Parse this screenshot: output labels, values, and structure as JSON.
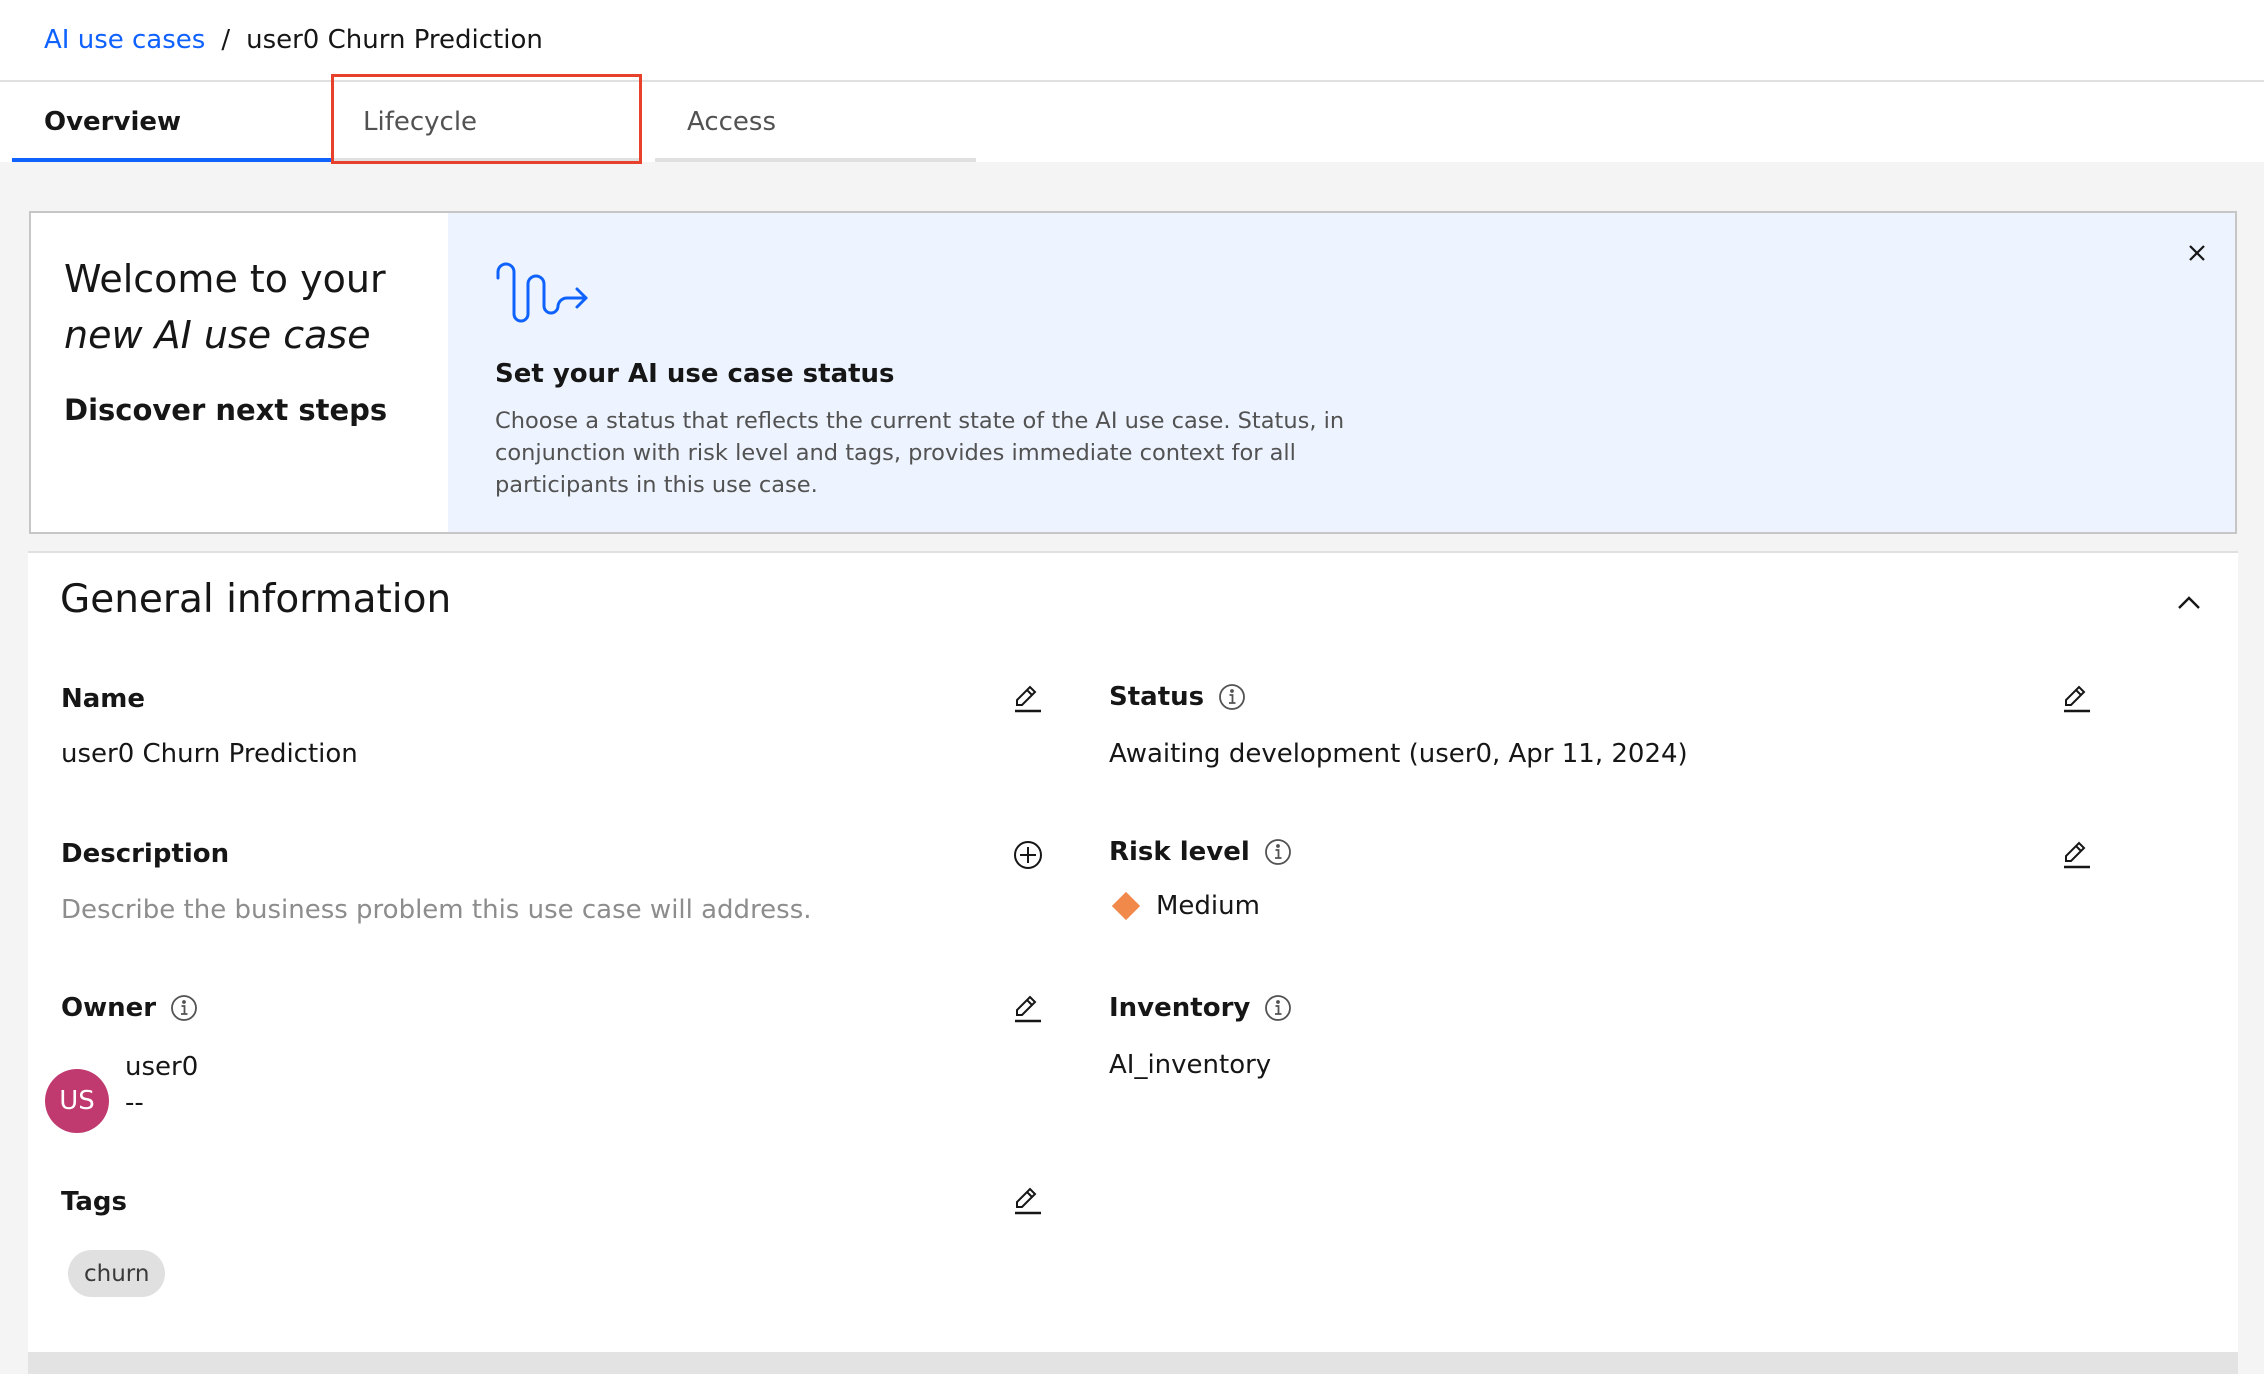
{
  "breadcrumb": {
    "parent": "AI use cases",
    "separator": "/",
    "current": "user0 Churn Prediction"
  },
  "tabs": [
    {
      "label": "Overview",
      "active": true
    },
    {
      "label": "Lifecycle",
      "active": false,
      "highlighted": true
    },
    {
      "label": "Access",
      "active": false
    }
  ],
  "banner": {
    "welcome_line1": "Welcome to your",
    "welcome_line2": "new AI use case",
    "discover": "Discover next steps",
    "icon": "path-arrow-icon",
    "step_title": "Set your AI use case status",
    "step_description": "Choose a status that reflects the current state of the AI use case. Status, in conjunction with risk level and tags, provides immediate context for all participants in this use case.",
    "close_icon": "close-icon"
  },
  "general_info": {
    "title": "General information",
    "collapse_icon": "chevron-up-icon",
    "fields": {
      "name": {
        "label": "Name",
        "value": "user0 Churn Prediction",
        "action_icon": "edit-icon"
      },
      "description": {
        "label": "Description",
        "placeholder": "Describe the business problem this use case will address.",
        "action_icon": "add-icon"
      },
      "owner": {
        "label": "Owner",
        "avatar_initials": "US",
        "name": "user0",
        "secondary": "--",
        "action_icon": "edit-icon"
      },
      "tags": {
        "label": "Tags",
        "values": [
          "churn"
        ],
        "action_icon": "edit-icon"
      },
      "status": {
        "label": "Status",
        "value": "Awaiting development (user0, Apr 11, 2024)",
        "action_icon": "edit-icon"
      },
      "risk_level": {
        "label": "Risk level",
        "value": "Medium",
        "color": "#f1894a",
        "action_icon": "edit-icon"
      },
      "inventory": {
        "label": "Inventory",
        "value": "AI_inventory"
      }
    }
  },
  "colors": {
    "accent": "#0f62fe",
    "highlight": "#e8412b",
    "avatar": "#c13a6f",
    "risk_medium": "#f1894a",
    "banner_bg": "#edf4ff"
  }
}
